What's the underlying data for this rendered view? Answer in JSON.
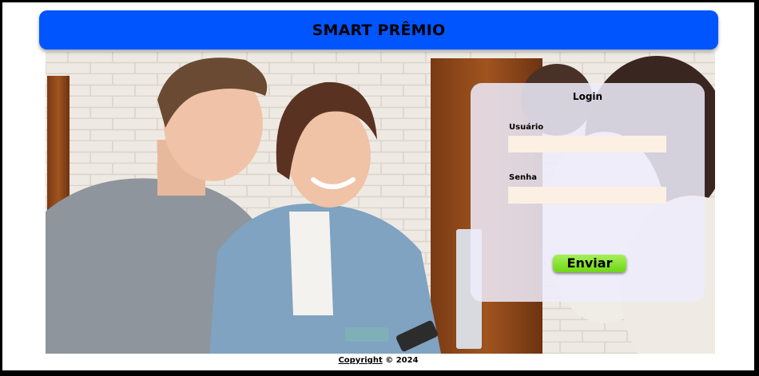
{
  "header": {
    "title": "SMART PRÊMIO"
  },
  "hero": {
    "image": "photo-of-three-people-studying-together-icon"
  },
  "login": {
    "title": "Login",
    "username_label": "Usuário",
    "username_value": "",
    "password_label": "Senha",
    "password_value": "",
    "submit_label": "Enviar"
  },
  "footer": {
    "link_text": "Copyright",
    "text": "© 2024"
  },
  "colors": {
    "header_bg": "#0055ff",
    "submit_bg": "#8ee63a",
    "input_bg": "#fbf0e3"
  }
}
